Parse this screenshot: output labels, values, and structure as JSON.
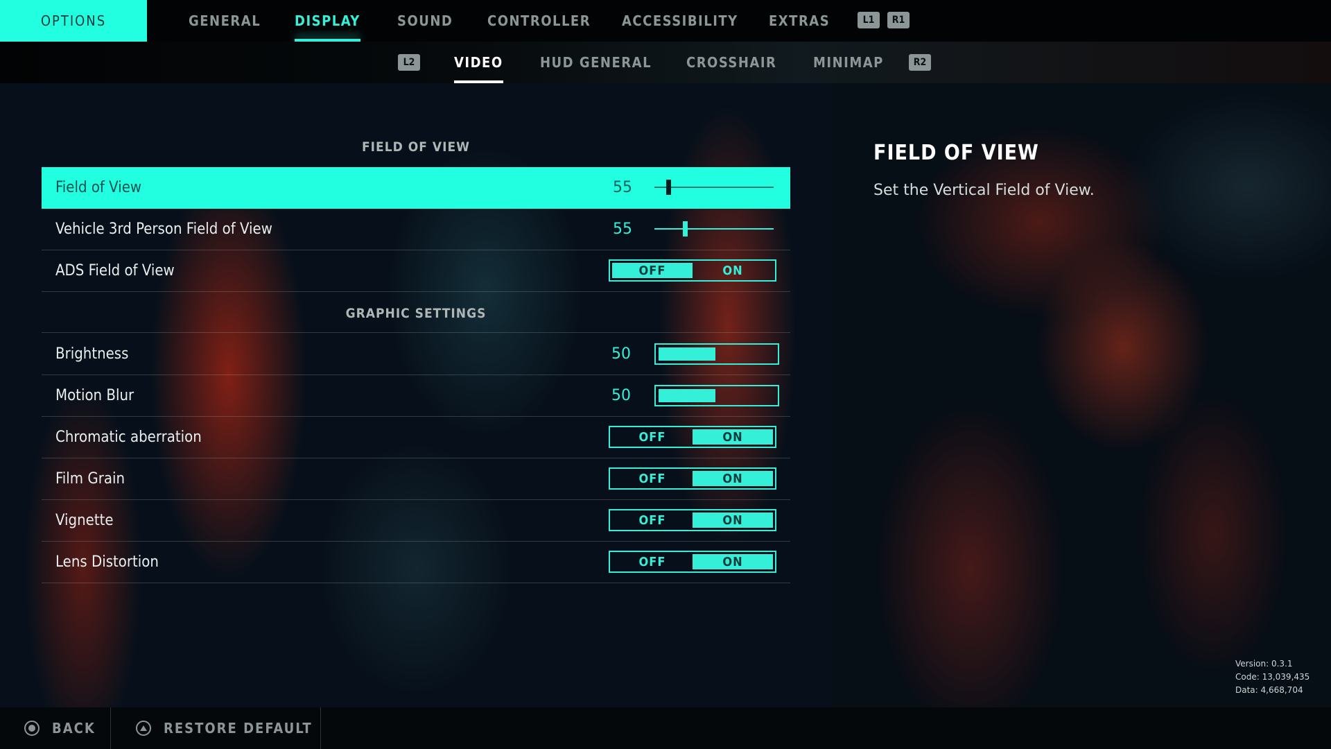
{
  "topnav": {
    "title": "OPTIONS",
    "tabs": [
      {
        "label": "GENERAL",
        "active": false
      },
      {
        "label": "DISPLAY",
        "active": true
      },
      {
        "label": "SOUND",
        "active": false
      },
      {
        "label": "CONTROLLER",
        "active": false
      },
      {
        "label": "ACCESSIBILITY",
        "active": false
      },
      {
        "label": "EXTRAS",
        "active": false
      }
    ],
    "prev_button": "L1",
    "next_button": "R1"
  },
  "subnav": {
    "prev_button": "L2",
    "next_button": "R2",
    "tabs": [
      {
        "label": "VIDEO",
        "active": true
      },
      {
        "label": "HUD GENERAL",
        "active": false
      },
      {
        "label": "CROSSHAIR",
        "active": false
      },
      {
        "label": "MINIMAP",
        "active": false
      }
    ]
  },
  "sections": {
    "fov": "FIELD OF VIEW",
    "graphics": "GRAPHIC SETTINGS"
  },
  "settings": {
    "field_of_view": {
      "label": "Field of View",
      "value": "55",
      "fraction": 0.1,
      "selected": true
    },
    "vehicle_fov": {
      "label": "Vehicle 3rd Person Field of View",
      "value": "55",
      "fraction": 0.25
    },
    "ads_fov": {
      "label": "ADS Field of View",
      "off": "OFF",
      "on": "ON",
      "state": "OFF"
    },
    "brightness": {
      "label": "Brightness",
      "value": "50",
      "fraction": 0.5
    },
    "motion_blur": {
      "label": "Motion Blur",
      "value": "50",
      "fraction": 0.5
    },
    "chromatic": {
      "label": "Chromatic aberration",
      "off": "OFF",
      "on": "ON",
      "state": "ON"
    },
    "film_grain": {
      "label": "Film Grain",
      "off": "OFF",
      "on": "ON",
      "state": "ON"
    },
    "vignette": {
      "label": "Vignette",
      "off": "OFF",
      "on": "ON",
      "state": "ON"
    },
    "lens_distortion": {
      "label": "Lens Distortion",
      "off": "OFF",
      "on": "ON",
      "state": "ON"
    }
  },
  "help": {
    "title": "FIELD OF VIEW",
    "text": "Set the Vertical Field of View."
  },
  "version": {
    "version": "Version: 0.3.1",
    "code": "Code: 13,039,435",
    "data": "Data: 4,668,704"
  },
  "footer": {
    "back": "BACK",
    "restore": "RESTORE DEFAULT"
  },
  "colors": {
    "accent": "#22ffe0",
    "toggle": "#35f0d8"
  }
}
